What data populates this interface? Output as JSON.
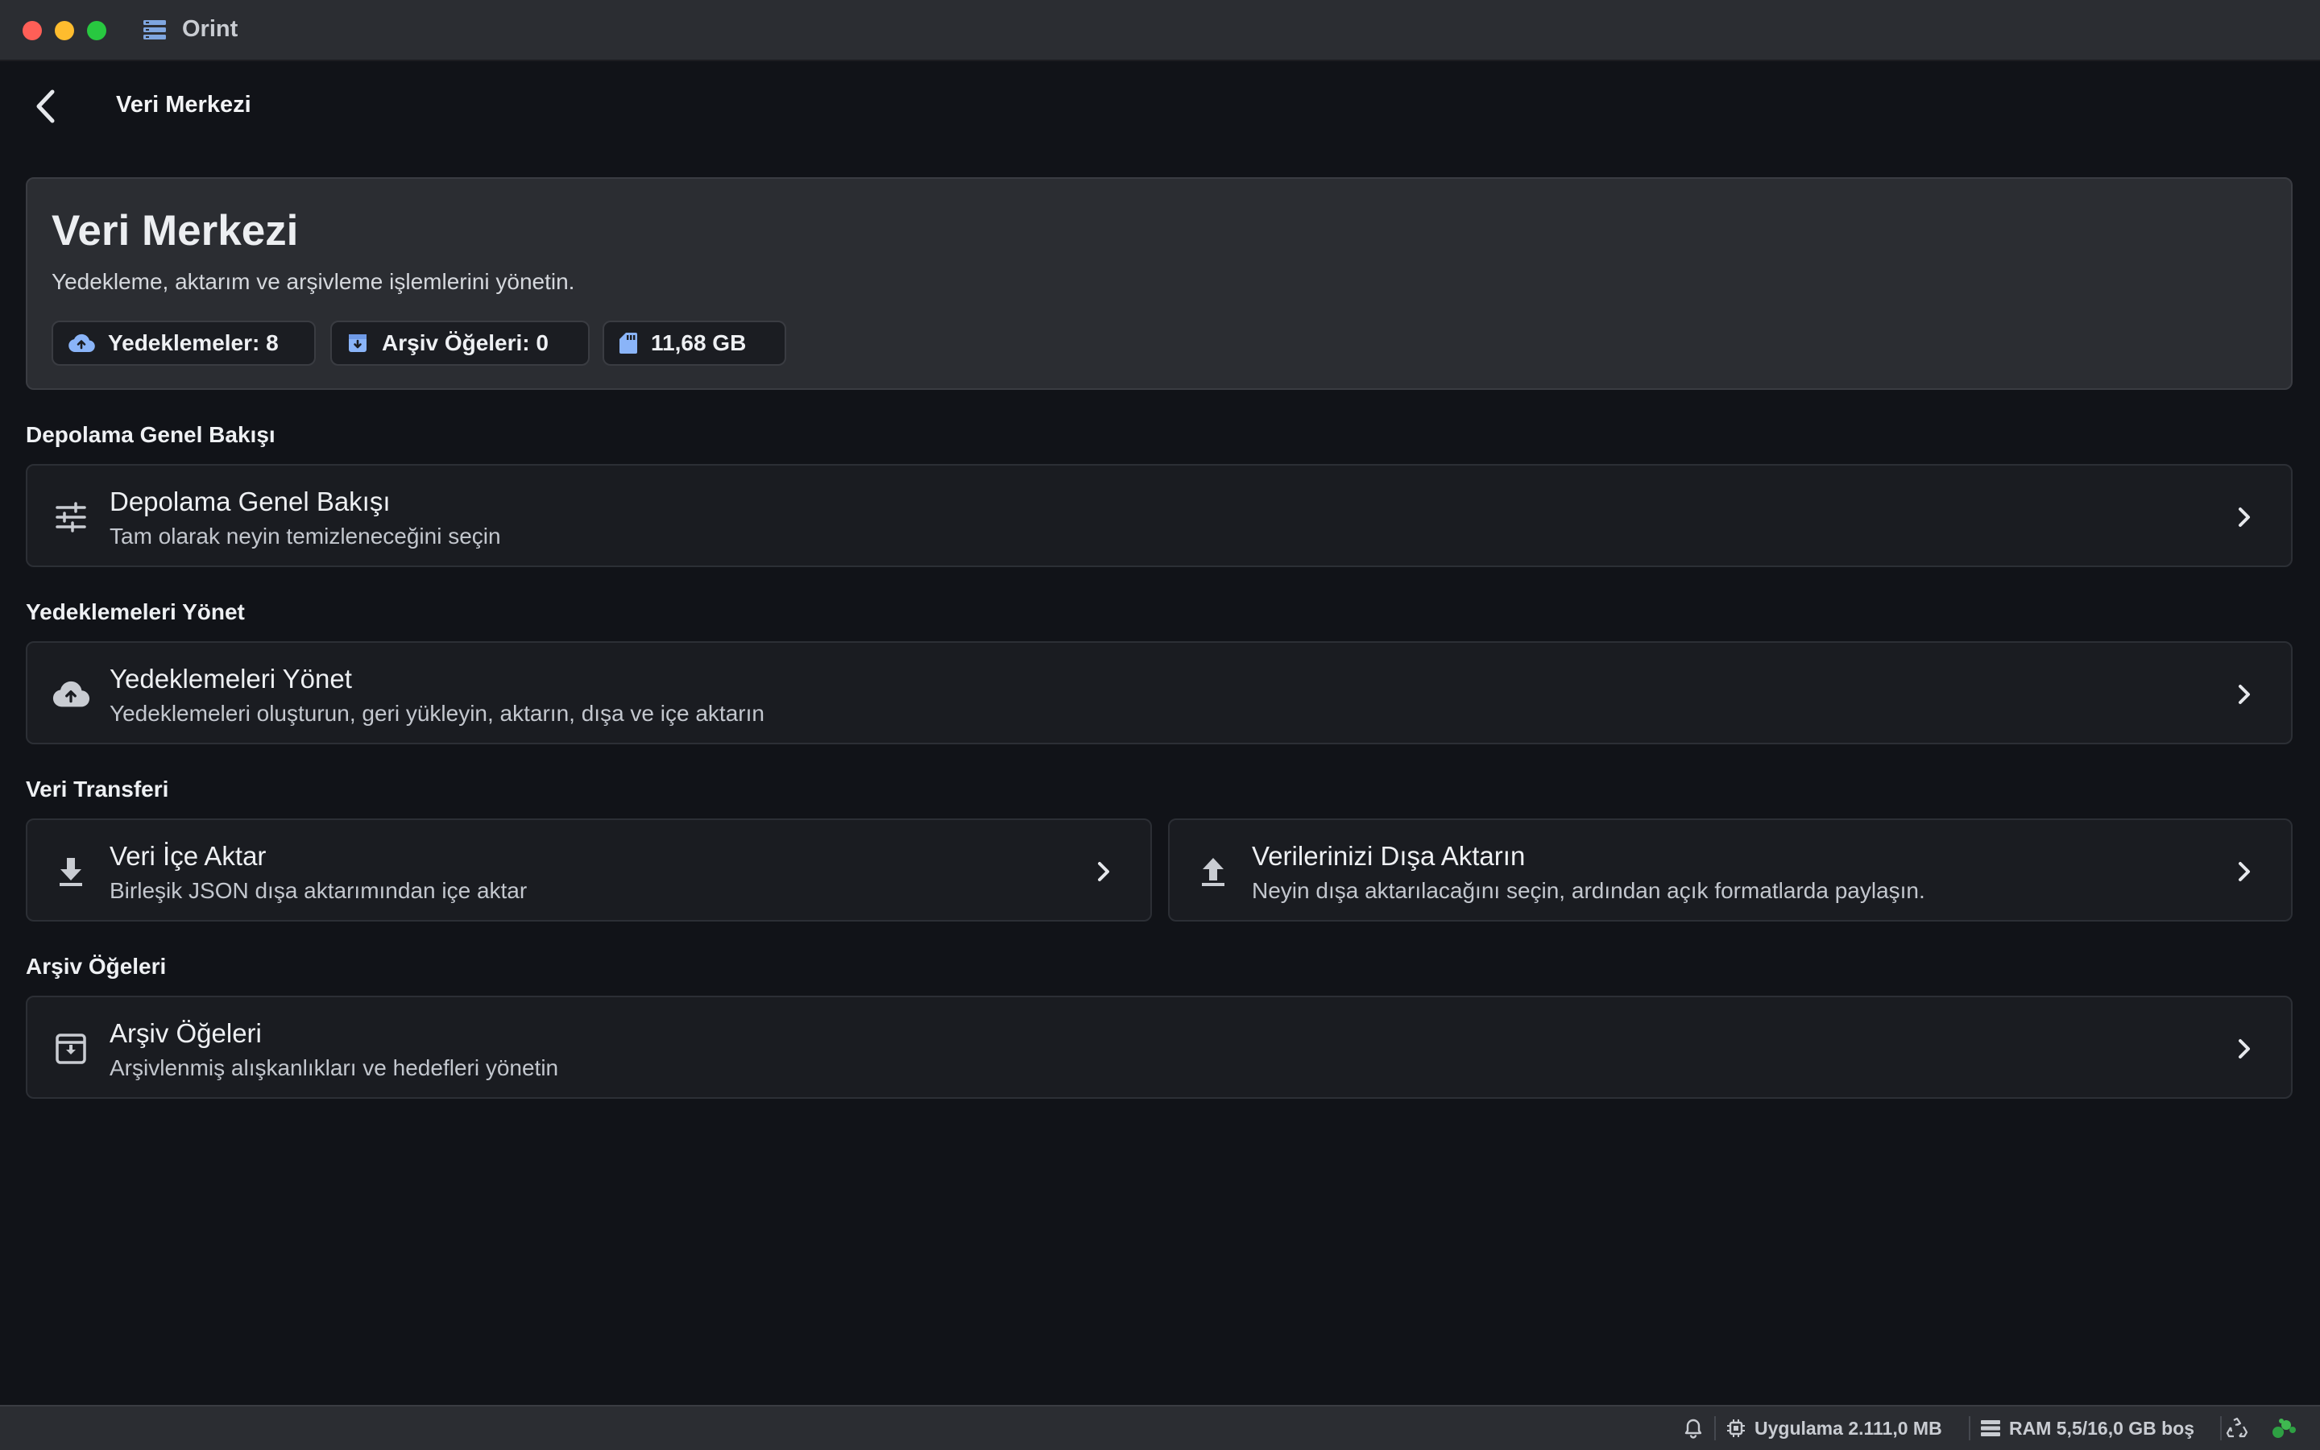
{
  "window": {
    "app_title": "Orint"
  },
  "header": {
    "title": "Veri Merkezi"
  },
  "hero": {
    "title": "Veri Merkezi",
    "subtitle": "Yedekleme, aktarım ve arşivleme işlemlerini yönetin.",
    "chips": [
      {
        "icon": "cloud-upload-icon",
        "label": "Yedeklemeler: 8"
      },
      {
        "icon": "archive-icon",
        "label": "Arşiv Öğeleri: 0"
      },
      {
        "icon": "sd-card-icon",
        "label": "11,68 GB"
      }
    ]
  },
  "sections": [
    {
      "label": "Depolama Genel Bakışı",
      "cards": [
        {
          "icon": "tune-icon",
          "title": "Depolama Genel Bakışı",
          "subtitle": "Tam olarak neyin temizleneceğini seçin"
        }
      ]
    },
    {
      "label": "Yedeklemeleri Yönet",
      "cards": [
        {
          "icon": "cloud-upload-icon",
          "title": "Yedeklemeleri Yönet",
          "subtitle": "Yedeklemeleri oluşturun, geri yükleyin, aktarın, dışa ve içe aktarın"
        }
      ]
    },
    {
      "label": "Veri Transferi",
      "cards": [
        {
          "icon": "download-icon",
          "title": "Veri İçe Aktar",
          "subtitle": "Birleşik JSON dışa aktarımından içe aktar"
        },
        {
          "icon": "upload-icon",
          "title": "Verilerinizi Dışa Aktarın",
          "subtitle": "Neyin dışa aktarılacağını seçin, ardından açık formatlarda paylaşın."
        }
      ]
    },
    {
      "label": "Arşiv Öğeleri",
      "cards": [
        {
          "icon": "archive-box-icon",
          "title": "Arşiv Öğeleri",
          "subtitle": "Arşivlenmiş alışkanlıkları ve hedefleri yönetin"
        }
      ]
    }
  ],
  "statusbar": {
    "app_memory": "Uygulama 2.111,0 MB",
    "ram": "RAM 5,5/16,0 GB boş"
  },
  "colors": {
    "background": "#111318",
    "card": "#1a1c21",
    "hero": "#2b2d32",
    "accent_icon": "#8ab4f8",
    "status_ok": "#3fb950"
  }
}
